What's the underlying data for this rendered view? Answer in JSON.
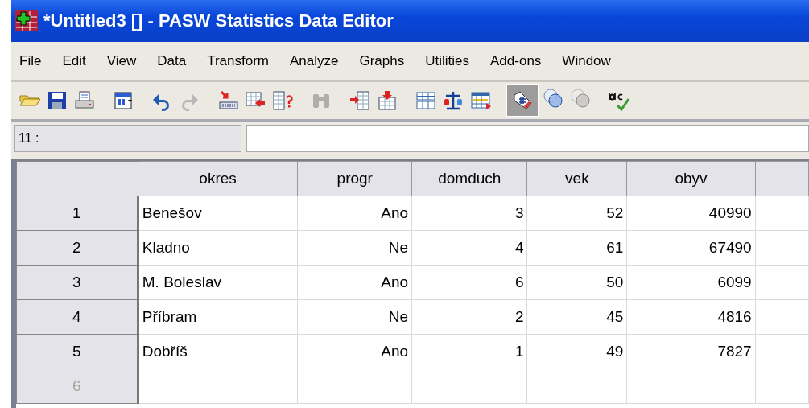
{
  "window": {
    "title": "*Untitled3 [] - PASW Statistics Data Editor"
  },
  "menu": [
    "File",
    "Edit",
    "View",
    "Data",
    "Transform",
    "Analyze",
    "Graphs",
    "Utilities",
    "Add-ons",
    "Window"
  ],
  "toolbar": [
    [
      {
        "kind": "open",
        "disabled": false,
        "pressed": false
      },
      {
        "kind": "save",
        "disabled": false,
        "pressed": false
      },
      {
        "kind": "print",
        "disabled": false,
        "pressed": false
      }
    ],
    [
      {
        "kind": "dialog",
        "disabled": false,
        "pressed": false
      }
    ],
    [
      {
        "kind": "undo",
        "disabled": false,
        "pressed": false
      },
      {
        "kind": "redo",
        "disabled": true,
        "pressed": false
      }
    ],
    [
      {
        "kind": "goto",
        "disabled": false,
        "pressed": false
      },
      {
        "kind": "gridarrow",
        "disabled": false,
        "pressed": false
      },
      {
        "kind": "gridquestion",
        "disabled": false,
        "pressed": false
      }
    ],
    [
      {
        "kind": "binoculars",
        "disabled": true,
        "pressed": false
      }
    ],
    [
      {
        "kind": "insertrow",
        "disabled": false,
        "pressed": false
      },
      {
        "kind": "insertcolumn",
        "disabled": false,
        "pressed": false
      }
    ],
    [
      {
        "kind": "split",
        "disabled": false,
        "pressed": false
      },
      {
        "kind": "scale",
        "disabled": false,
        "pressed": false
      },
      {
        "kind": "select",
        "disabled": false,
        "pressed": false
      }
    ],
    [
      {
        "kind": "tag",
        "disabled": false,
        "pressed": true
      },
      {
        "kind": "circles",
        "disabled": false,
        "pressed": false
      },
      {
        "kind": "circles",
        "disabled": true,
        "pressed": false
      }
    ],
    [
      {
        "kind": "spell",
        "disabled": false,
        "pressed": false
      }
    ]
  ],
  "cell_editor": {
    "reference": "11 :"
  },
  "table": {
    "columns": [
      {
        "name": "okres",
        "kind": "string"
      },
      {
        "name": "progr",
        "kind": "numeric"
      },
      {
        "name": "domduch",
        "kind": "numeric"
      },
      {
        "name": "vek",
        "kind": "numeric"
      },
      {
        "name": "obyv",
        "kind": "numeric"
      }
    ],
    "rows": [
      {
        "number": "1",
        "filled": true,
        "cells": [
          "Benešov",
          "Ano",
          "3",
          "52",
          "40990"
        ]
      },
      {
        "number": "2",
        "filled": true,
        "cells": [
          "Kladno",
          "Ne",
          "4",
          "61",
          "67490"
        ]
      },
      {
        "number": "3",
        "filled": true,
        "cells": [
          "M. Boleslav",
          "Ano",
          "6",
          "50",
          "6099"
        ]
      },
      {
        "number": "4",
        "filled": true,
        "cells": [
          "Příbram",
          "Ne",
          "2",
          "45",
          "4816"
        ]
      },
      {
        "number": "5",
        "filled": true,
        "cells": [
          "Dobříš",
          "Ano",
          "1",
          "49",
          "7827"
        ]
      },
      {
        "number": "6",
        "filled": false,
        "cells": []
      }
    ]
  }
}
